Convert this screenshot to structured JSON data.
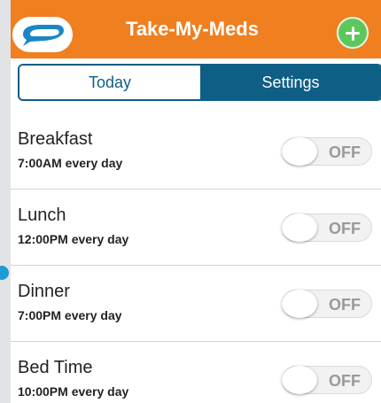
{
  "header": {
    "title": "Take-My-Meds",
    "add_button_icon": "plus-icon",
    "logo_icon": "pill-logo-icon"
  },
  "tabs": [
    {
      "label": "Today",
      "selected": true
    },
    {
      "label": "Settings",
      "selected": false
    }
  ],
  "reminders": [
    {
      "name": "Breakfast",
      "time": "7:00AM every day",
      "toggle": "OFF"
    },
    {
      "name": "Lunch",
      "time": "12:00PM every day",
      "toggle": "OFF"
    },
    {
      "name": "Dinner",
      "time": "7:00PM every day",
      "toggle": "OFF"
    },
    {
      "name": "Bed Time",
      "time": "10:00PM every day",
      "toggle": "OFF"
    }
  ],
  "colors": {
    "header": "#f07f1f",
    "tab_active_bg": "#0e5e85",
    "add_button": "#5cc85b",
    "accent_blue": "#1e9ad6"
  }
}
